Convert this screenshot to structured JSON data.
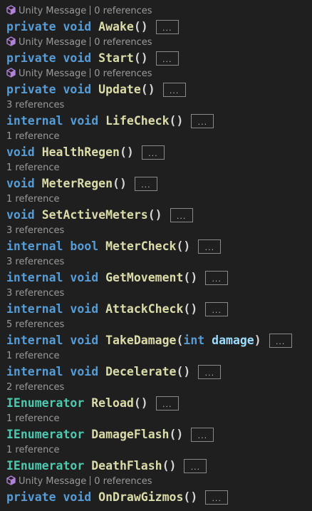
{
  "lines": [
    {
      "lens": {
        "icon": "unity-icon",
        "label": "Unity Message",
        "refs": "0 references"
      },
      "tokens": [
        {
          "t": "kw",
          "v": "private"
        },
        {
          "t": "sp",
          "v": " "
        },
        {
          "t": "kw",
          "v": "void"
        },
        {
          "t": "sp",
          "v": " "
        },
        {
          "t": "fn",
          "v": "Awake"
        },
        {
          "t": "punc",
          "v": "()"
        }
      ]
    },
    {
      "lens": {
        "icon": "unity-icon",
        "label": "Unity Message",
        "refs": "0 references"
      },
      "tokens": [
        {
          "t": "kw",
          "v": "private"
        },
        {
          "t": "sp",
          "v": " "
        },
        {
          "t": "kw",
          "v": "void"
        },
        {
          "t": "sp",
          "v": " "
        },
        {
          "t": "fn",
          "v": "Start"
        },
        {
          "t": "punc",
          "v": "()"
        }
      ]
    },
    {
      "lens": {
        "icon": "unity-icon",
        "label": "Unity Message",
        "refs": "0 references"
      },
      "tokens": [
        {
          "t": "kw",
          "v": "private"
        },
        {
          "t": "sp",
          "v": " "
        },
        {
          "t": "kw",
          "v": "void"
        },
        {
          "t": "sp",
          "v": " "
        },
        {
          "t": "fn",
          "v": "Update"
        },
        {
          "t": "punc",
          "v": "()"
        }
      ]
    },
    {
      "lens": {
        "refs": "3 references"
      },
      "tokens": [
        {
          "t": "kw",
          "v": "internal"
        },
        {
          "t": "sp",
          "v": " "
        },
        {
          "t": "kw",
          "v": "void"
        },
        {
          "t": "sp",
          "v": " "
        },
        {
          "t": "fn",
          "v": "LifeCheck"
        },
        {
          "t": "punc",
          "v": "()"
        }
      ]
    },
    {
      "lens": {
        "refs": "1 reference"
      },
      "tokens": [
        {
          "t": "kw",
          "v": "void"
        },
        {
          "t": "sp",
          "v": " "
        },
        {
          "t": "fn",
          "v": "HealthRegen"
        },
        {
          "t": "punc",
          "v": "()"
        }
      ]
    },
    {
      "lens": {
        "refs": "1 reference"
      },
      "tokens": [
        {
          "t": "kw",
          "v": "void"
        },
        {
          "t": "sp",
          "v": " "
        },
        {
          "t": "fn",
          "v": "MeterRegen"
        },
        {
          "t": "punc",
          "v": "()"
        }
      ]
    },
    {
      "lens": {
        "refs": "1 reference"
      },
      "tokens": [
        {
          "t": "kw",
          "v": "void"
        },
        {
          "t": "sp",
          "v": " "
        },
        {
          "t": "fn",
          "v": "SetActiveMeters"
        },
        {
          "t": "punc",
          "v": "()"
        }
      ]
    },
    {
      "lens": {
        "refs": "3 references"
      },
      "tokens": [
        {
          "t": "kw",
          "v": "internal"
        },
        {
          "t": "sp",
          "v": " "
        },
        {
          "t": "kw",
          "v": "bool"
        },
        {
          "t": "sp",
          "v": " "
        },
        {
          "t": "fn",
          "v": "MeterCheck"
        },
        {
          "t": "punc",
          "v": "()"
        }
      ]
    },
    {
      "lens": {
        "refs": "3 references"
      },
      "tokens": [
        {
          "t": "kw",
          "v": "internal"
        },
        {
          "t": "sp",
          "v": " "
        },
        {
          "t": "kw",
          "v": "void"
        },
        {
          "t": "sp",
          "v": " "
        },
        {
          "t": "fn",
          "v": "GetMovement"
        },
        {
          "t": "punc",
          "v": "()"
        }
      ]
    },
    {
      "lens": {
        "refs": "3 references"
      },
      "tokens": [
        {
          "t": "kw",
          "v": "internal"
        },
        {
          "t": "sp",
          "v": " "
        },
        {
          "t": "kw",
          "v": "void"
        },
        {
          "t": "sp",
          "v": " "
        },
        {
          "t": "fn",
          "v": "AttackCheck"
        },
        {
          "t": "punc",
          "v": "()"
        }
      ]
    },
    {
      "lens": {
        "refs": "5 references"
      },
      "tokens": [
        {
          "t": "kw",
          "v": "internal"
        },
        {
          "t": "sp",
          "v": " "
        },
        {
          "t": "kw",
          "v": "void"
        },
        {
          "t": "sp",
          "v": " "
        },
        {
          "t": "fn",
          "v": "TakeDamage"
        },
        {
          "t": "punc",
          "v": "("
        },
        {
          "t": "kw",
          "v": "int"
        },
        {
          "t": "sp",
          "v": " "
        },
        {
          "t": "param",
          "v": "damage"
        },
        {
          "t": "punc",
          "v": ")"
        }
      ]
    },
    {
      "lens": {
        "refs": "1 reference"
      },
      "tokens": [
        {
          "t": "kw",
          "v": "internal"
        },
        {
          "t": "sp",
          "v": " "
        },
        {
          "t": "kw",
          "v": "void"
        },
        {
          "t": "sp",
          "v": " "
        },
        {
          "t": "fn",
          "v": "Decelerate"
        },
        {
          "t": "punc",
          "v": "()"
        }
      ]
    },
    {
      "lens": {
        "refs": "2 references"
      },
      "tokens": [
        {
          "t": "type",
          "v": "IEnumerator"
        },
        {
          "t": "sp",
          "v": " "
        },
        {
          "t": "fn",
          "v": "Reload"
        },
        {
          "t": "punc",
          "v": "()"
        }
      ]
    },
    {
      "lens": {
        "refs": "1 reference"
      },
      "tokens": [
        {
          "t": "type",
          "v": "IEnumerator"
        },
        {
          "t": "sp",
          "v": " "
        },
        {
          "t": "fn",
          "v": "DamageFlash"
        },
        {
          "t": "punc",
          "v": "()"
        }
      ]
    },
    {
      "lens": {
        "refs": "1 reference"
      },
      "tokens": [
        {
          "t": "type",
          "v": "IEnumerator"
        },
        {
          "t": "sp",
          "v": " "
        },
        {
          "t": "fn",
          "v": "DeathFlash"
        },
        {
          "t": "punc",
          "v": "()"
        }
      ]
    },
    {
      "lens": {
        "icon": "unity-icon",
        "label": "Unity Message",
        "refs": "0 references"
      },
      "tokens": [
        {
          "t": "kw",
          "v": "private"
        },
        {
          "t": "sp",
          "v": " "
        },
        {
          "t": "kw",
          "v": "void"
        },
        {
          "t": "sp",
          "v": " "
        },
        {
          "t": "fn",
          "v": "OnDrawGizmos"
        },
        {
          "t": "punc",
          "v": "()"
        }
      ]
    }
  ],
  "fold_label": "...",
  "colors": {
    "background": "#1f1f1f",
    "keyword": "#569cd6",
    "type": "#4ec9b0",
    "method": "#dcdcaa",
    "parameter": "#9cdcfe",
    "punctuation": "#d4d4d4",
    "codelens": "#9a9a9a",
    "unity_icon": "#b180d7"
  }
}
